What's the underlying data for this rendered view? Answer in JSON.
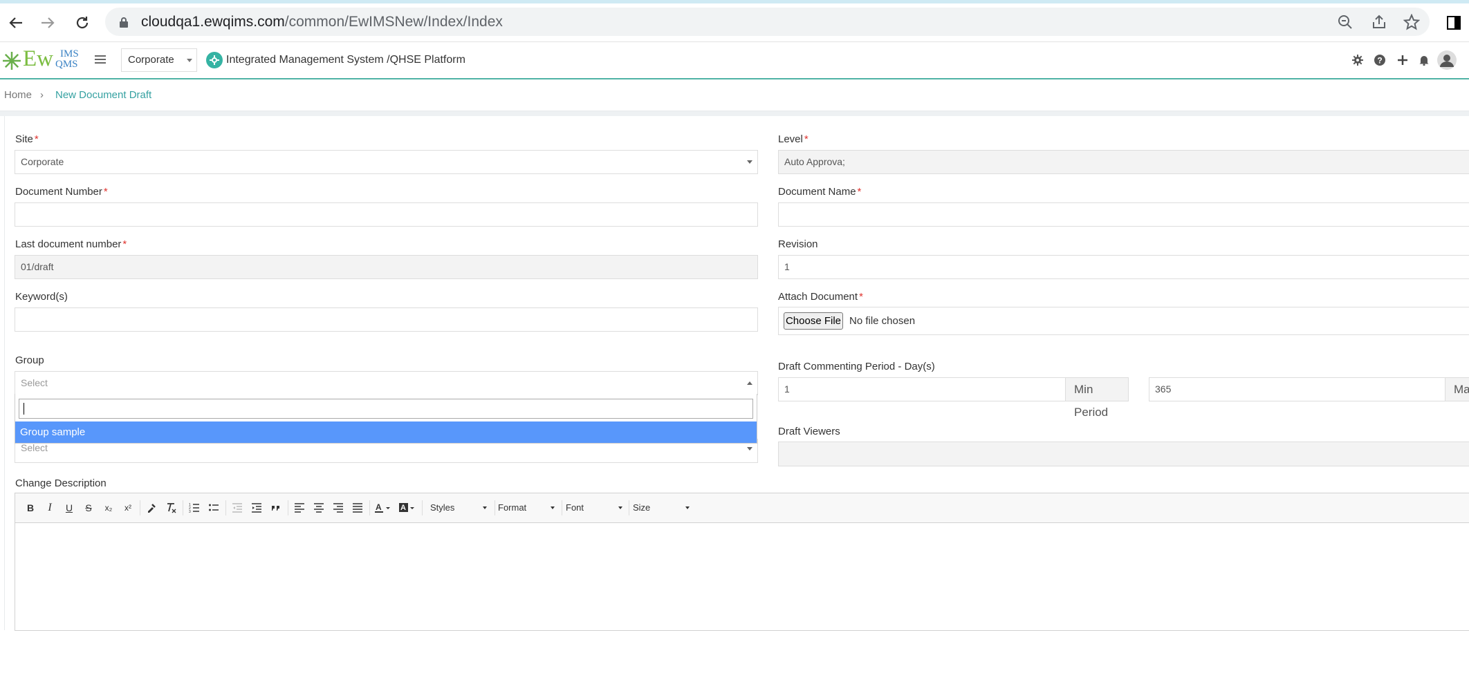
{
  "browser": {
    "url_host": "cloudqa1.ewqims.com",
    "url_path": "/common/EwIMSNew/Index/Index",
    "icons": [
      "back-icon",
      "forward-icon",
      "reload-icon",
      "lock-icon",
      "zoom-icon",
      "share-icon",
      "star-icon",
      "sidebar-icon"
    ]
  },
  "header": {
    "logo_ew": "Ew",
    "logo_ims": "IMS",
    "logo_qms": "QMS",
    "site_value": "Corporate",
    "title": "Integrated Management System /QHSE Platform",
    "icons": [
      "gear-icon",
      "help-icon",
      "plus-icon",
      "bell-icon",
      "user-avatar-icon"
    ]
  },
  "breadcrumb": {
    "home": "Home",
    "separator": "›",
    "current": "New Document Draft"
  },
  "form": {
    "site": {
      "label": "Site",
      "required": "*",
      "value": "Corporate"
    },
    "level": {
      "label": "Level",
      "required": "*",
      "value": "Auto Approva;"
    },
    "document_number": {
      "label": "Document Number",
      "required": "*",
      "value": ""
    },
    "document_name": {
      "label": "Document Name",
      "required": "*",
      "value": ""
    },
    "last_document_number": {
      "label": "Last document number",
      "required": "*",
      "value": "01/draft"
    },
    "revision": {
      "label": "Revision",
      "value": "1"
    },
    "keywords": {
      "label": "Keyword(s)",
      "value": ""
    },
    "attach": {
      "label": "Attach Document",
      "required": "*",
      "button": "Choose File",
      "status": "No file chosen"
    },
    "group": {
      "label": "Group",
      "placeholder": "Select",
      "option": "Group sample"
    },
    "second_select": {
      "placeholder": "Select"
    },
    "draft_period": {
      "label": "Draft Commenting Period - Day(s)",
      "min_value": "1",
      "min_addon": "Min Period",
      "max_value": "365",
      "max_addon": "Ma"
    },
    "draft_viewers": {
      "label": "Draft Viewers"
    },
    "change_description": {
      "label": "Change Description"
    }
  },
  "editor": {
    "buttons": [
      "B",
      "I",
      "U",
      "S",
      "x₂",
      "x²"
    ],
    "combos": [
      "Styles",
      "Format",
      "Font",
      "Size"
    ]
  },
  "colors": {
    "accent": "#35b3a3",
    "breadcrumb_active": "#35a1a1",
    "required": "#e0342f",
    "dropdown_highlight": "#5897fb"
  }
}
